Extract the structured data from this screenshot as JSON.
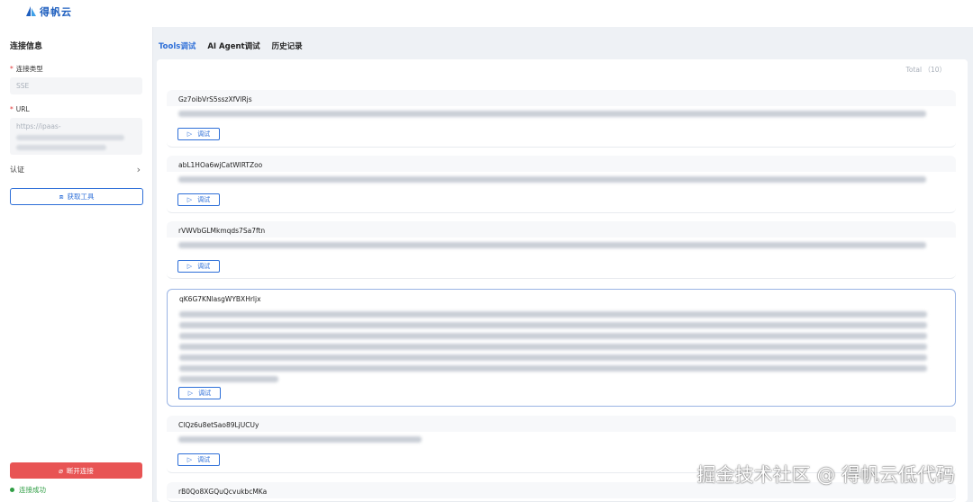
{
  "app": {
    "logo_text": "得帆云"
  },
  "sidebar": {
    "title": "连接信息",
    "conn_type_label": "连接类型",
    "conn_type_value": "SSE",
    "url_label": "URL",
    "url_value": "https://ipaas-",
    "auth_label": "认证",
    "fetch_button": "获取工具",
    "disconnect_button": "断开连接",
    "status_text": "连接成功"
  },
  "tabs": [
    {
      "label": "Tools调试",
      "active": true
    },
    {
      "label": "AI Agent调试",
      "active": false
    },
    {
      "label": "历史记录",
      "active": false
    }
  ],
  "main": {
    "total_text": "Total （10）",
    "debug_label": "调试",
    "tools": [
      {
        "name": "Gz7oibVrS5sszXfVlRjs"
      },
      {
        "name": "abL1HOa6wjCatWlRTZoo"
      },
      {
        "name": "rVWVbGLMkmqds7Sa7ftn"
      },
      {
        "name": "qK6G7KNlasgWYBXHrljx"
      },
      {
        "name": "ClQz6u8etSao89LjUCUy"
      },
      {
        "name": "rB0Qo8XGQuQcvukbcMKa"
      }
    ]
  },
  "watermark": "掘金技术社区 @ 得帆云低代码",
  "colors": {
    "accent": "#2e6fd8",
    "danger": "#e85454",
    "success": "#2f9e44"
  }
}
